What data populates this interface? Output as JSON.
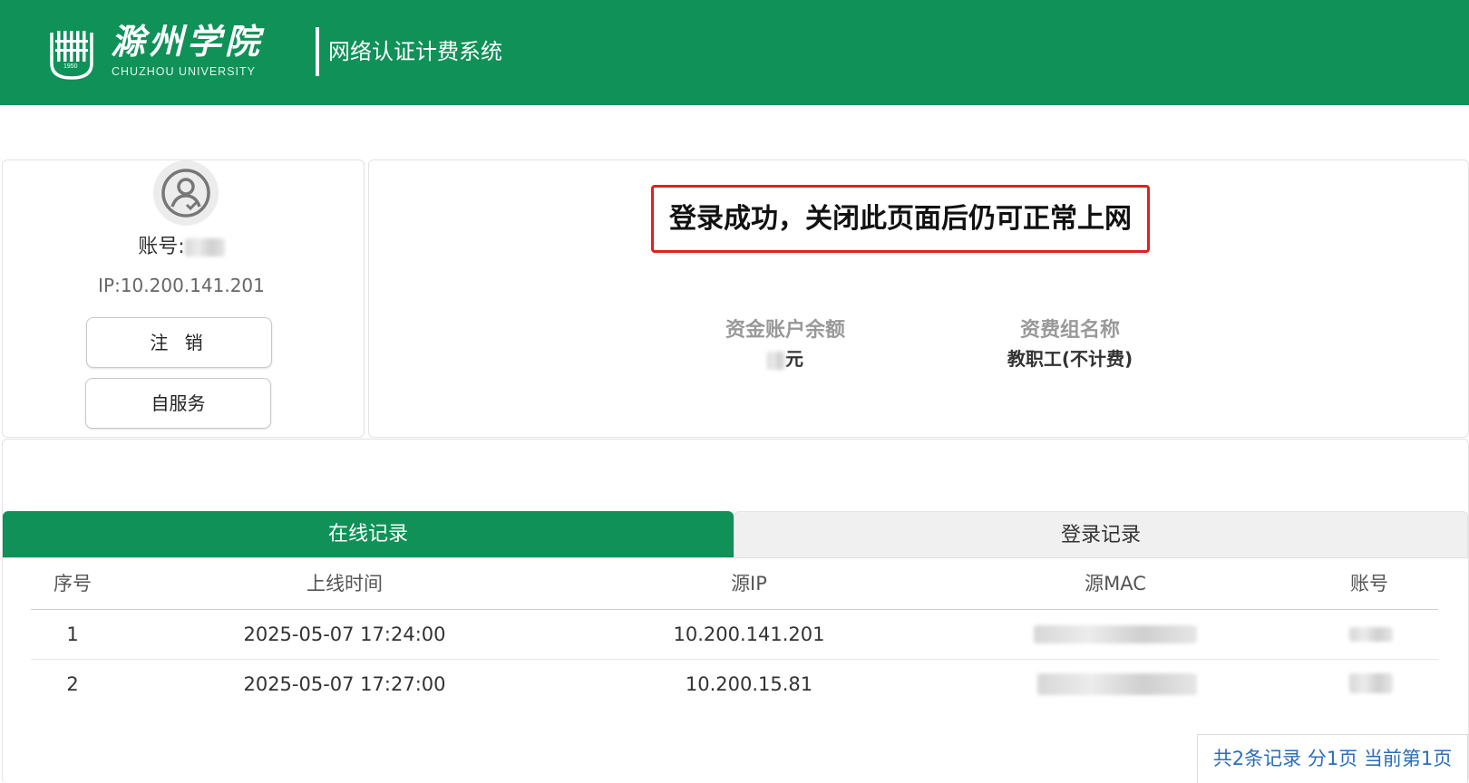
{
  "header": {
    "logo_cn": "滁州学院",
    "logo_en": "CHUZHOU UNIVERSITY",
    "logo_year": "1950",
    "system_title": "网络认证计费系统",
    "brand_color": "#0f9158"
  },
  "user": {
    "account_label": "账号:",
    "ip_text": "IP:10.200.141.201",
    "logout_label": "注 销",
    "self_service_label": "自服务"
  },
  "status": {
    "success_message": "登录成功，关闭此页面后仍可正常上网",
    "balance_label": "资金账户余额",
    "balance_unit": "元",
    "group_label": "资费组名称",
    "group_value": "教职工(不计费)"
  },
  "tabs": [
    {
      "label": "在线记录",
      "active": true
    },
    {
      "label": "登录记录",
      "active": false
    }
  ],
  "table": {
    "headers": [
      "序号",
      "上线时间",
      "源IP",
      "源MAC",
      "账号"
    ],
    "rows": [
      {
        "index": "1",
        "time": "2025-05-07 17:24:00",
        "ip": "10.200.141.201"
      },
      {
        "index": "2",
        "time": "2025-05-07 17:27:00",
        "ip": "10.200.15.81"
      }
    ]
  },
  "pager": {
    "text": "共2条记录 分1页 当前第1页"
  }
}
